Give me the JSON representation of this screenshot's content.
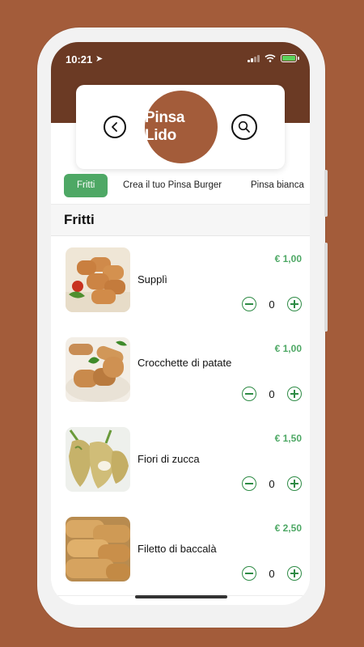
{
  "status_bar": {
    "time": "10:21",
    "location_glyph": "➤"
  },
  "header": {
    "logo_text": "Pinsa Lido",
    "back_icon": "chevron-left-icon",
    "search_icon": "search-icon"
  },
  "tabs": [
    {
      "label": "Fritti",
      "active": true
    },
    {
      "label": "Crea il tuo Pinsa Burger",
      "active": false
    },
    {
      "label": "Pinsa bianca",
      "active": false
    }
  ],
  "section": {
    "title": "Fritti"
  },
  "items": [
    {
      "name": "Supplì",
      "price": "€ 1,00",
      "qty": "0"
    },
    {
      "name": "Crocchette di patate",
      "price": "€ 1,00",
      "qty": "0"
    },
    {
      "name": "Fiori di zucca",
      "price": "€ 1,50",
      "qty": "0"
    },
    {
      "name": "Filetto di baccalà",
      "price": "€ 2,50",
      "qty": "0"
    }
  ],
  "colors": {
    "brand": "#a35c3a",
    "header": "#6b3a24",
    "accent": "#4ea865"
  }
}
